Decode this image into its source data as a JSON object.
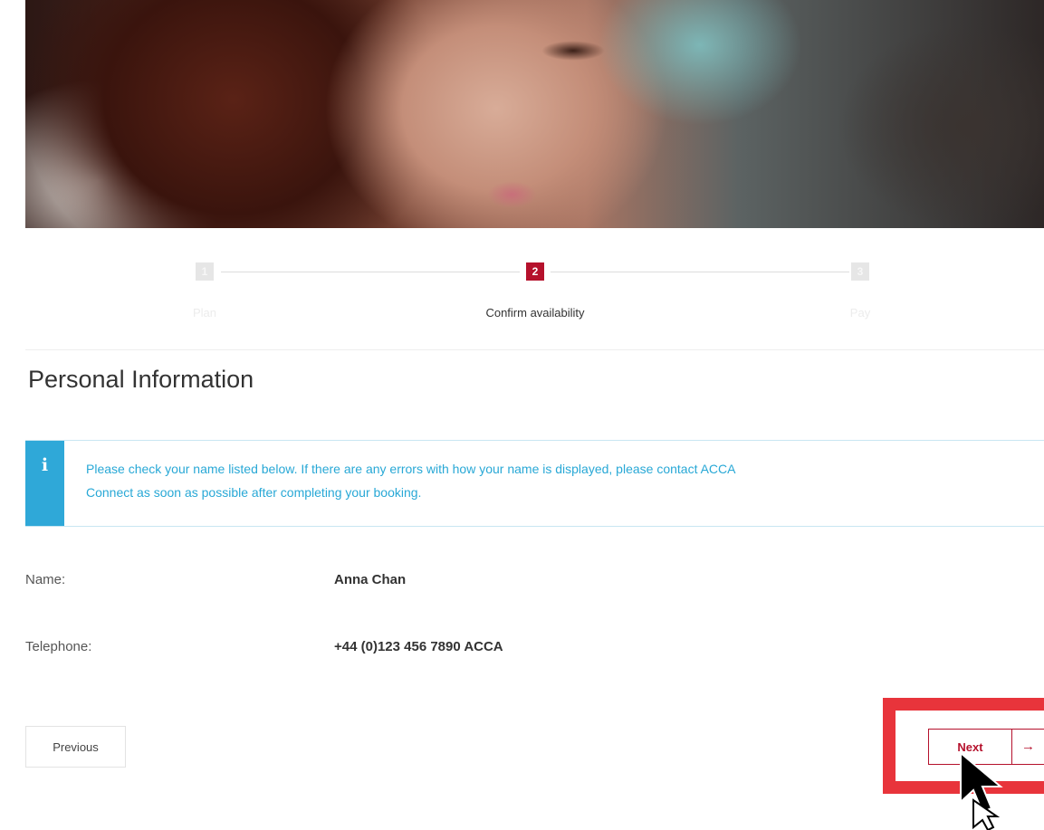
{
  "hero": {
    "image": "student-photo"
  },
  "steps": [
    {
      "number": "1",
      "label": "Plan",
      "state": "inactive"
    },
    {
      "number": "2",
      "label": "Confirm availability",
      "state": "active"
    },
    {
      "number": "3",
      "label": "Pay",
      "state": "inactive"
    }
  ],
  "section_title": "Personal Information",
  "info": {
    "icon": "i",
    "line1": "Please check your name listed below. If there are any errors with how your name is displayed, please contact ACCA",
    "line2": "Connect as soon as possible after completing your booking."
  },
  "details": {
    "name_label": "Name:",
    "name_value": "Anna Chan",
    "tel_label": "Telephone:",
    "tel_value": "+44 (0)123 456 7890 ACCA"
  },
  "buttons": {
    "previous": "Previous",
    "next": "Next",
    "next_arrow": "→"
  },
  "colors": {
    "accent": "#b5112c",
    "info": "#2fa8d8",
    "highlight": "#e8343b"
  }
}
